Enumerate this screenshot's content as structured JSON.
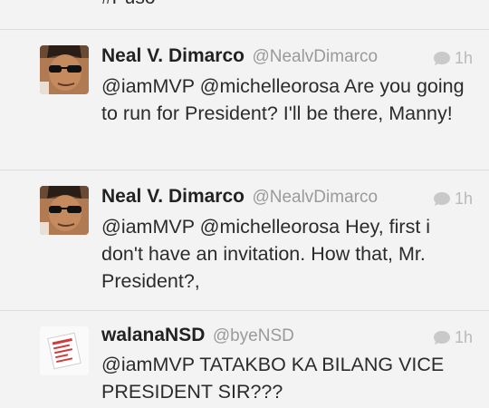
{
  "timeline": {
    "partial_tweet_text": "#Puso",
    "tweets": [
      {
        "name": "Neal V. Dimarco",
        "handle": "@NealvDimarco",
        "time": "1h",
        "text": "@iamMVP @michelleorosa Are you going to run for President? I'll be there, Manny!",
        "avatar_icon": "user-avatar-sunglasses"
      },
      {
        "name": "Neal V. Dimarco",
        "handle": "@NealvDimarco",
        "time": "1h",
        "text": "@iamMVP @michelleorosa Hey, first i don't have an invitation. How that, Mr. President?,",
        "avatar_icon": "user-avatar-sunglasses"
      },
      {
        "name": "walanaNSD",
        "handle": "@byeNSD",
        "time": "1h",
        "text": "@iamMVP TATAKBO KA BILANG VICE PRESIDENT SIR???",
        "avatar_icon": "user-avatar-card"
      }
    ]
  },
  "colors": {
    "background": "#f3f3f3",
    "name": "#222222",
    "handle": "#9a9a9a",
    "meta": "#b9b9b9",
    "divider": "#dedede"
  }
}
